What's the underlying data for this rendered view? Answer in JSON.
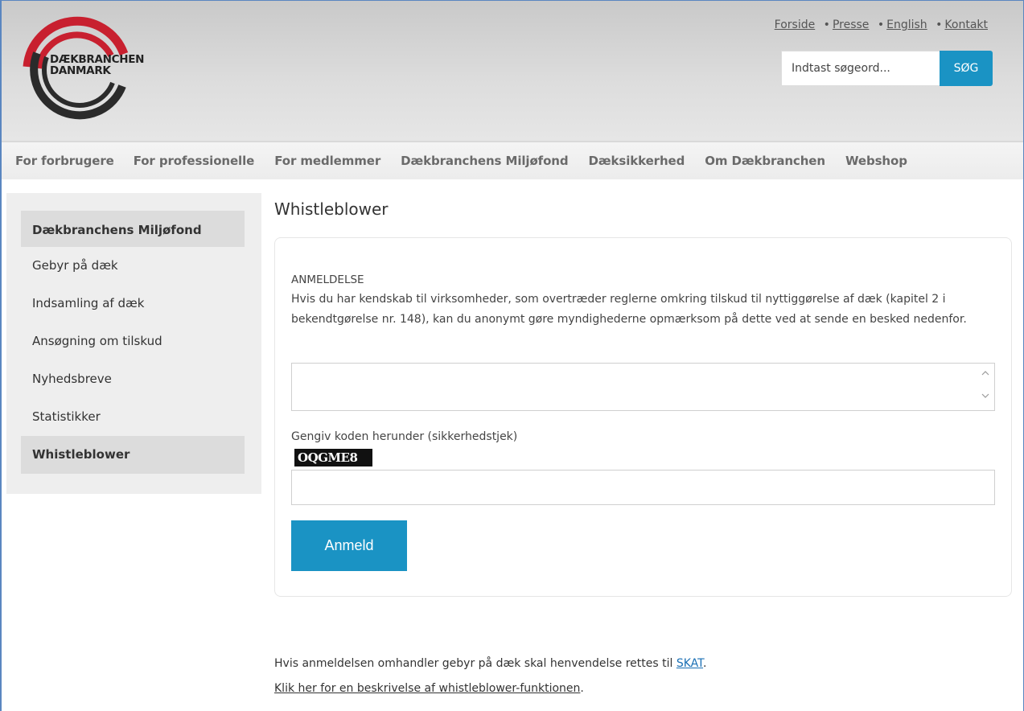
{
  "logo": {
    "line1": "DÆKBRANCHEN",
    "line2": "DANMARK"
  },
  "top_links": [
    {
      "label": "Forside"
    },
    {
      "label": "Presse"
    },
    {
      "label": "English"
    },
    {
      "label": "Kontakt"
    }
  ],
  "top_link_separator": "•",
  "search": {
    "placeholder": "Indtast søgeord...",
    "button_label": "SØG"
  },
  "nav": {
    "items": [
      "For forbrugere",
      "For professionelle",
      "For medlemmer",
      "Dækbranchens Miljøfond",
      "Dæksikkerhed",
      "Om Dækbranchen",
      "Webshop"
    ]
  },
  "sidebar": {
    "items": [
      "Dækbranchens Miljøfond",
      "Gebyr på dæk",
      "Indsamling af dæk",
      "Ansøgning om tilskud",
      "Nyhedsbreve",
      "Statistikker",
      "Whistleblower"
    ],
    "active": [
      "Dækbranchens Miljøfond",
      "Whistleblower"
    ]
  },
  "page": {
    "title": "Whistleblower",
    "section_label": "ANMELDELSE",
    "section_text": "Hvis du har kendskab til virksomheder, som overtræder reglerne omkring tilskud til nyttiggørelse af dæk (kapitel 2 i bekendtgørelse nr. 148), kan du anonymt gøre myndighederne opmærksom på dette ved at sende en besked nedenfor.",
    "captcha_label": "Gengiv koden herunder (sikkerhedstjek)",
    "captcha_code": "OQGME8",
    "submit_label": "Anmeld"
  },
  "footer": {
    "line1_prefix": "Hvis anmeldelsen omhandler gebyr på dæk skal henvendelse rettes til ",
    "line1_link": "SKAT",
    "line1_suffix": ".",
    "line2_link": "Klik her for en beskrivelse af whistleblower-funktionen",
    "line2_suffix": "."
  },
  "colors": {
    "accent": "#1a93c4",
    "logo_red": "#c8202f",
    "logo_dark": "#2b2b2b"
  }
}
